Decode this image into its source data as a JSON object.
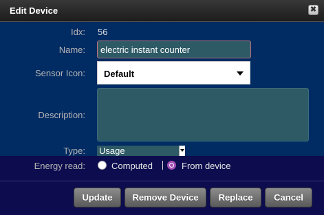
{
  "dialog": {
    "title": "Edit Device",
    "close_symbol": "✖"
  },
  "fields": {
    "idx_label": "Idx:",
    "idx_value": "56",
    "name_label": "Name:",
    "name_value": "electric instant counter",
    "sensor_icon_label": "Sensor Icon:",
    "sensor_icon_value": "Default",
    "description_label": "Description:",
    "description_value": "",
    "type_label": "Type:",
    "type_value": "Usage",
    "energy_read_label": "Energy read:",
    "energy_read_options": [
      {
        "label": "Computed",
        "checked": false
      },
      {
        "label": "From device",
        "checked": true
      }
    ]
  },
  "buttons": {
    "update": "Update",
    "remove_device": "Remove Device",
    "replace": "Replace",
    "cancel": "Cancel"
  },
  "colors": {
    "form_background": "#002b63",
    "dialog_background": "#0c0c4e",
    "input_background": "#2e5a66",
    "radio_checked": "#a24fb4"
  }
}
